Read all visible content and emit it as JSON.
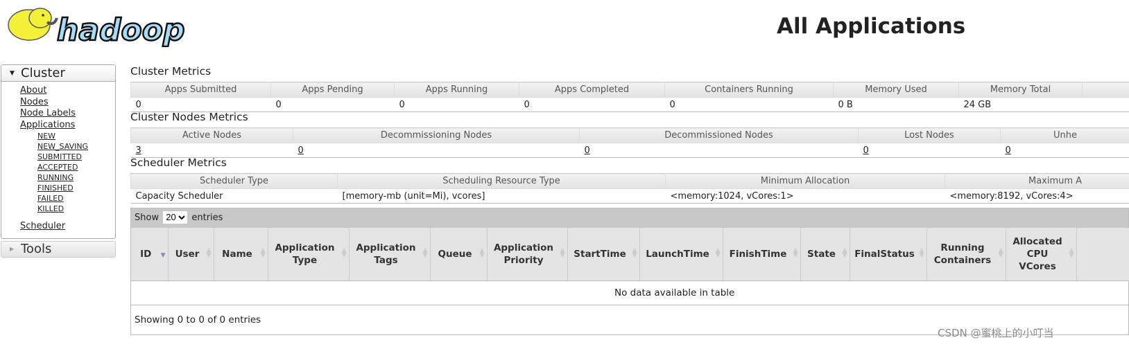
{
  "header": {
    "logo_text": "hadoop",
    "title": "All Applications"
  },
  "sidebar": {
    "cluster_label": "Cluster",
    "links": [
      "About",
      "Nodes",
      "Node Labels",
      "Applications"
    ],
    "app_states": [
      "NEW",
      "NEW_SAVING",
      "SUBMITTED",
      "ACCEPTED",
      "RUNNING",
      "FINISHED",
      "FAILED",
      "KILLED"
    ],
    "scheduler": "Scheduler",
    "tools_label": "Tools"
  },
  "cluster_metrics": {
    "title": "Cluster Metrics",
    "headers": [
      "Apps Submitted",
      "Apps Pending",
      "Apps Running",
      "Apps Completed",
      "Containers Running",
      "Memory Used",
      "Memory Total",
      ""
    ],
    "values": [
      "0",
      "0",
      "0",
      "0",
      "0",
      "0 B",
      "24 GB",
      ""
    ]
  },
  "nodes_metrics": {
    "title": "Cluster Nodes Metrics",
    "headers": [
      "Active Nodes",
      "Decommissioning Nodes",
      "Decommissioned Nodes",
      "Lost Nodes",
      "Unhe"
    ],
    "values": [
      "3",
      "0",
      "0",
      "0",
      "0"
    ]
  },
  "scheduler_metrics": {
    "title": "Scheduler Metrics",
    "headers": [
      "Scheduler Type",
      "Scheduling Resource Type",
      "Minimum Allocation",
      "Maximum A"
    ],
    "values": [
      "Capacity Scheduler",
      "[memory-mb (unit=Mi), vcores]",
      "<memory:1024, vCores:1>",
      "<memory:8192, vCores:4>"
    ]
  },
  "apps_table": {
    "show_label": "Show",
    "page_size": "20",
    "entries_label": "entries",
    "columns": [
      "ID",
      "User",
      "Name",
      "Application Type",
      "Application Tags",
      "Queue",
      "Application Priority",
      "StartTime",
      "LaunchTime",
      "FinishTime",
      "State",
      "FinalStatus",
      "Running Containers",
      "Allocated CPU VCores",
      ""
    ],
    "empty_message": "No data available in table",
    "info": "Showing 0 to 0 of 0 entries"
  },
  "watermark": "CSDN @蜜桃上的小叮当"
}
